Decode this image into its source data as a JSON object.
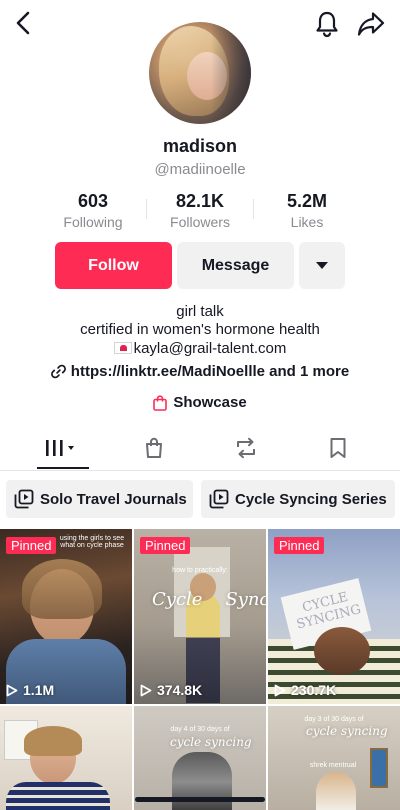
{
  "header": {
    "icons": [
      "back-arrow-icon",
      "bell-icon",
      "share-icon"
    ]
  },
  "profile": {
    "name": "madison",
    "handle": "@madiinoelle",
    "stats": [
      {
        "value": "603",
        "label": "Following"
      },
      {
        "value": "82.1K",
        "label": "Followers"
      },
      {
        "value": "5.2M",
        "label": "Likes"
      }
    ],
    "buttons": {
      "follow": "Follow",
      "message": "Message"
    },
    "bio": {
      "line1": "girl talk",
      "line2": "certified in women's hormone health",
      "email": "kayla@grail-talent.com"
    },
    "link": "https://linktr.ee/MadiNoellle and 1 more",
    "showcase": "Showcase"
  },
  "tabs": [
    {
      "name": "videos",
      "icon": "grid-icon",
      "active": true
    },
    {
      "name": "shop",
      "icon": "shopping-bag-icon"
    },
    {
      "name": "reposts",
      "icon": "repost-icon"
    },
    {
      "name": "saved",
      "icon": "bookmark-icon"
    }
  ],
  "playlists": [
    {
      "label": "Solo Travel Journals"
    },
    {
      "label": "Cycle Syncing Series"
    }
  ],
  "videos": [
    {
      "pinned_label": "Pinned",
      "views": "1.1M",
      "caption": "using the girls to see\nwhat on cycle phase"
    },
    {
      "pinned_label": "Pinned",
      "views": "374.8K",
      "heading": "how to practically:",
      "overlay": "Cycle    Sync"
    },
    {
      "pinned_label": "Pinned",
      "views": "230.7K",
      "sign": "CYCLE\nSYNCING"
    },
    {
      "views": ""
    },
    {
      "subtitle": "day 4 of 30 days of",
      "overlay": "cycle syncing"
    },
    {
      "subtitle": "day 3 of 30 days of",
      "overlay": "cycle syncing",
      "caption": "shrek mentrual"
    }
  ],
  "colors": {
    "accent": "#fe2c55",
    "text": "#161823",
    "muted": "#8a8b91",
    "button_gray": "#f1f1f2"
  }
}
